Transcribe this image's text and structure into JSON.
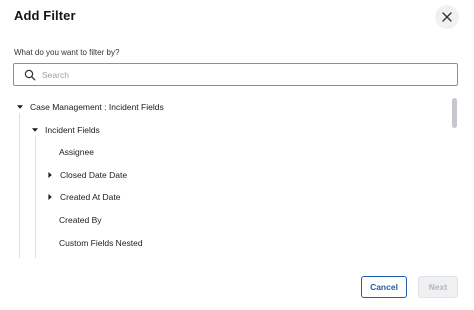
{
  "dialog": {
    "title": "Add Filter",
    "close_icon": "close-icon"
  },
  "filter": {
    "label": "What do you want to filter by?",
    "search_placeholder": "Search",
    "search_value": ""
  },
  "tree": {
    "items": [
      {
        "label": "Case Management : Incident Fields",
        "caret": "expanded"
      },
      {
        "label": "Incident Fields",
        "caret": "expanded"
      },
      {
        "label": "Assignee",
        "caret": "none"
      },
      {
        "label": "Closed Date Date",
        "caret": "collapsed"
      },
      {
        "label": "Created At Date",
        "caret": "collapsed"
      },
      {
        "label": "Created By",
        "caret": "none"
      },
      {
        "label": "Custom Fields Nested",
        "caret": "none"
      }
    ]
  },
  "footer": {
    "cancel_label": "Cancel",
    "next_label": "Next",
    "next_disabled": true
  },
  "colors": {
    "primary": "#1f5fa8",
    "border": "#8a8f98",
    "disabled_text": "#b3b7bd"
  }
}
